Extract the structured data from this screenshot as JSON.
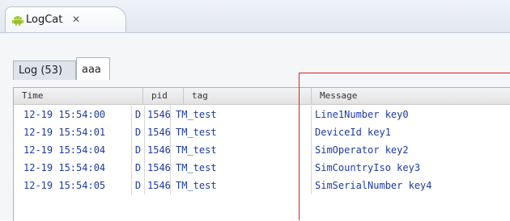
{
  "view_tab": {
    "title": "LogCat",
    "close_glyph": "✕",
    "icon": "android-icon"
  },
  "filter_tabs": [
    {
      "label": "Log (53)"
    },
    {
      "label": "aaa"
    }
  ],
  "columns": {
    "time": "Time",
    "pid": "pid",
    "tag": "tag",
    "message": "Message"
  },
  "rows": [
    {
      "time": "12-19 15:54:00",
      "level": "D",
      "pid": "1546",
      "tag": "TM_test",
      "message": "Line1Number key0"
    },
    {
      "time": "12-19 15:54:01",
      "level": "D",
      "pid": "1546",
      "tag": "TM_test",
      "message": "DeviceId key1"
    },
    {
      "time": "12-19 15:54:04",
      "level": "D",
      "pid": "1546",
      "tag": "TM_test",
      "message": "SimOperator key2"
    },
    {
      "time": "12-19 15:54:04",
      "level": "D",
      "pid": "1546",
      "tag": "TM_test",
      "message": "SimCountryIso key3"
    },
    {
      "time": "12-19 15:54:05",
      "level": "D",
      "pid": "1546",
      "tag": "TM_test",
      "message": "SimSerialNumber key4"
    }
  ],
  "colors": {
    "log_text": "#1e3aa0",
    "annotation": "#e01e1e",
    "android_green": "#97c024"
  }
}
